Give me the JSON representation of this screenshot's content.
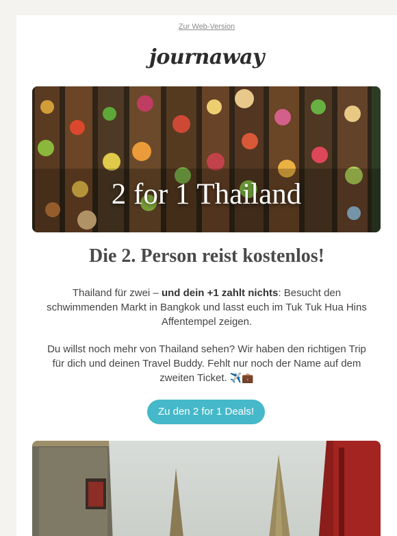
{
  "header": {
    "web_version_link": "Zur Web-Version",
    "logo_text": "journaway"
  },
  "hero": {
    "title": "2 for 1 Thailand",
    "image": "floating-market-boats-aerial"
  },
  "content": {
    "headline": "Die 2. Person reist kostenlos!",
    "paragraph1_pre": "Thailand für zwei – ",
    "paragraph1_bold": "und dein +1 zahlt nichts",
    "paragraph1_post": ": Besucht den schwimmenden Markt in Bangkok und lasst euch im Tuk Tuk Hua Hins Affentempel zeigen.",
    "paragraph2": "Du willst noch mehr von Thailand sehen? Wir haben den richtigen Trip für dich und deinen Travel Buddy. Fehlt nur noch der Name auf dem zweiten Ticket.",
    "paragraph2_emoji": "✈️💼"
  },
  "cta": {
    "label": "Zu den 2 for 1 Deals!",
    "color": "#45b8c9"
  },
  "second_image": {
    "image": "thai-temple-spires"
  },
  "colors": {
    "background": "#f4f3ef",
    "card": "#ffffff",
    "headline": "#4a4a4a",
    "body_text": "#444444"
  }
}
